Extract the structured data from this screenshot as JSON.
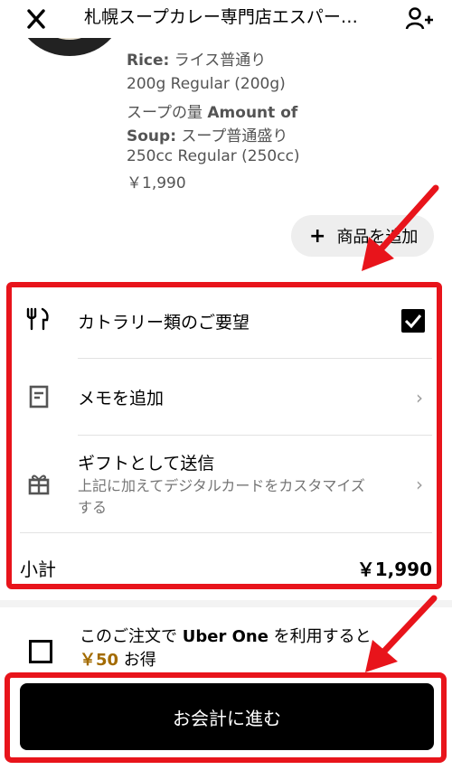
{
  "header": {
    "title": "札幌スープカレー専門店エスパー…",
    "close_icon": "close-icon",
    "add_user_icon": "add-person-icon"
  },
  "item": {
    "rice_label": "Rice:",
    "rice_value": " ライス普通り",
    "rice_detail": "200g Regular (200g)",
    "soup_label_jp": "スープの量 ",
    "soup_label_en": "Amount of Soup:",
    "soup_value": " スープ普通盛り",
    "soup_detail": "250cc Regular (250cc)",
    "price": "￥1,990"
  },
  "add_item_button": {
    "label": "商品を追加",
    "icon": "plus-icon"
  },
  "options": {
    "cutlery": {
      "label": "カトラリー類のご要望",
      "icon": "cutlery-icon",
      "checked": true
    },
    "memo": {
      "label": "メモを追加",
      "icon": "note-icon"
    },
    "gift": {
      "label": "ギフトとして送信",
      "sub": "上記に加えてデジタルカードをカスタマイズする",
      "icon": "gift-icon"
    }
  },
  "subtotal": {
    "label": "小計",
    "value": "￥1,990"
  },
  "uber_one": {
    "text_pre": "このご注文で ",
    "brand": "Uber One",
    "text_post": " を利用すると",
    "save_amount": "￥50",
    "save_suffix": " お得"
  },
  "checkout_button": {
    "label": "お会計に進む"
  },
  "colors": {
    "highlight": "#e8141b",
    "savings": "#a36b00"
  }
}
